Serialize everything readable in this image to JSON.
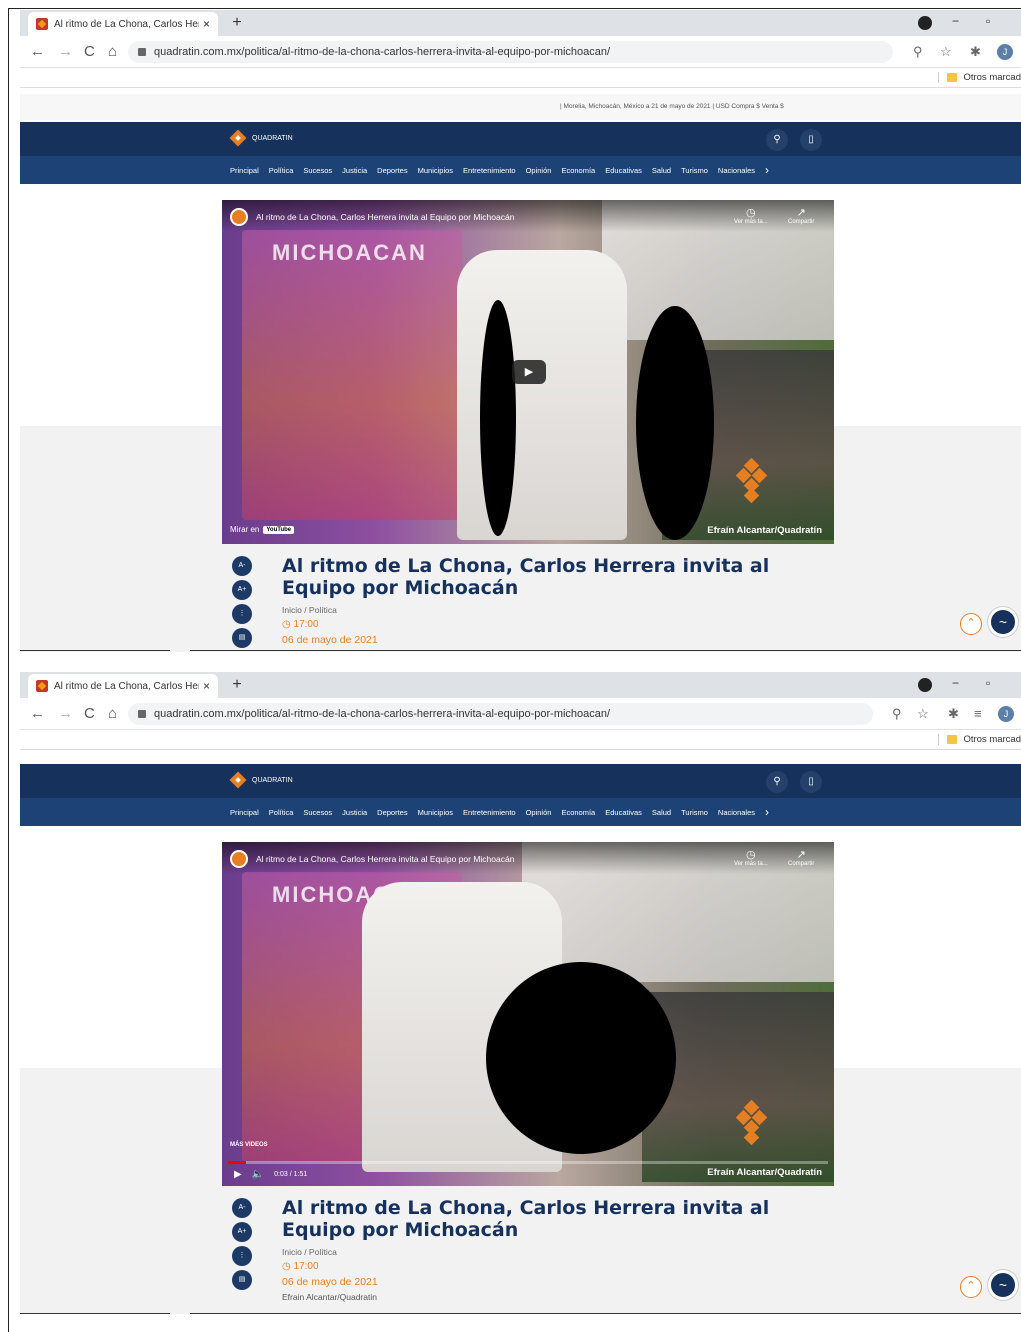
{
  "browser": {
    "tab_title": "Al ritmo de La Chona, Carlos Her",
    "tab_close": "×",
    "new_tab": "+",
    "url": "quadratin.com.mx/politica/al-ritmo-de-la-chona-carlos-herrera-invita-al-equipo-por-michoacan/",
    "bookmark_folder": "Otros marcad",
    "profile_initial": "J"
  },
  "site": {
    "util_text": "| Morelia, Michoacán, México a 21 de mayo de 2021 | USD Compra $ Venta $",
    "logo_text": "QUADRATIN",
    "menu": [
      "Principal",
      "Política",
      "Sucesos",
      "Justicia",
      "Deportes",
      "Municipios",
      "Entretenimiento",
      "Opinión",
      "Economía",
      "Educativas",
      "Salud",
      "Turismo",
      "Nacionales"
    ]
  },
  "video": {
    "title": "Al ritmo de La Chona, Carlos Herrera invita al Equipo por Michoacán",
    "poster_text": "MICHOACAN",
    "watch_later": "Ver más ta...",
    "share": "Compartir",
    "watch_on": "Mirar en",
    "youtube": "YouTube",
    "credit": "Efraín Alcantar/Quadratín",
    "more_videos": "MÁS VIDEOS",
    "time": "0:03 / 1:51",
    "progress": 0.03
  },
  "article": {
    "title": "Al ritmo de La Chona, Carlos Herrera invita al Equipo por Michoacán",
    "breadcrumb": "Inicio / Política",
    "time": "17:00",
    "date": "06 de mayo de 2021",
    "author": "Efrain Alcantar/Quadratin"
  },
  "tools": [
    "A-",
    "A+",
    "⋮",
    "▤"
  ],
  "icons": {
    "back": "←",
    "forward": "→",
    "reload": "C",
    "home": "⌂",
    "zoom": "⚲",
    "star": "☆",
    "extensions": "✱",
    "search": "⚲",
    "mobile": "▯",
    "play": "▶",
    "volume": "🔈",
    "scroll_top": "⌃",
    "messenger": "~",
    "chevron": "›",
    "minimize": "−",
    "restore": "▫",
    "clock": "◷",
    "share": "↗",
    "reading_list": "≡"
  }
}
